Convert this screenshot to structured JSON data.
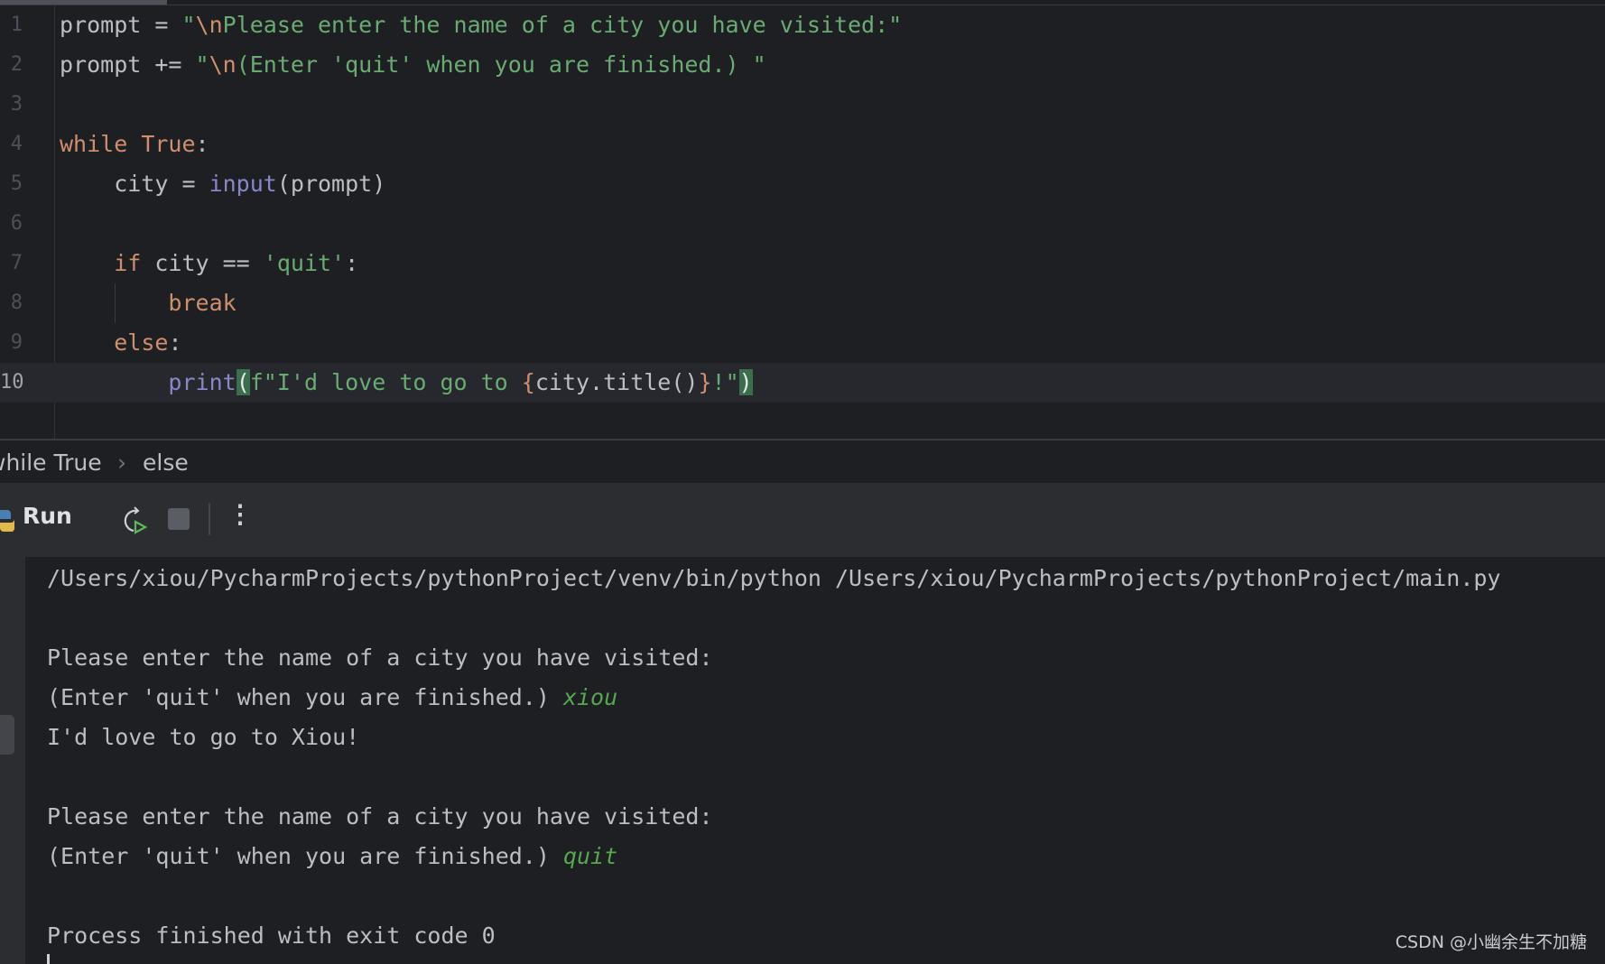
{
  "editor": {
    "lines": [
      {
        "n": "1",
        "tokens": [
          [
            "",
            "prompt = "
          ],
          [
            "str",
            "\""
          ],
          [
            "esc",
            "\\n"
          ],
          [
            "str",
            "Please enter the name of a city you have visited:\""
          ]
        ]
      },
      {
        "n": "2",
        "tokens": [
          [
            "",
            "prompt += "
          ],
          [
            "str",
            "\""
          ],
          [
            "esc",
            "\\n"
          ],
          [
            "str",
            "(Enter 'quit' when you are finished.) \""
          ]
        ]
      },
      {
        "n": "3",
        "tokens": []
      },
      {
        "n": "4",
        "tokens": [
          [
            "kw",
            "while "
          ],
          [
            "kw",
            "True"
          ],
          [
            "",
            ":"
          ]
        ]
      },
      {
        "n": "5",
        "tokens": [
          [
            "",
            "    city = "
          ],
          [
            "bi",
            "input"
          ],
          [
            "",
            "(prompt)"
          ]
        ]
      },
      {
        "n": "6",
        "tokens": []
      },
      {
        "n": "7",
        "tokens": [
          [
            "",
            "    "
          ],
          [
            "kw",
            "if"
          ],
          [
            "",
            " city == "
          ],
          [
            "str",
            "'quit'"
          ],
          [
            "",
            ":"
          ]
        ]
      },
      {
        "n": "8",
        "tokens": [
          [
            "",
            "        "
          ],
          [
            "kw",
            "break"
          ]
        ]
      },
      {
        "n": "9",
        "tokens": [
          [
            "",
            "    "
          ],
          [
            "kw",
            "else"
          ],
          [
            "",
            ":"
          ]
        ]
      },
      {
        "n": "10",
        "tokens": [
          [
            "",
            "        "
          ],
          [
            "bi",
            "print"
          ],
          [
            "hl",
            "("
          ],
          [
            "str",
            "f\"I'd love to go to "
          ],
          [
            "br",
            "{"
          ],
          [
            "",
            "city.title()"
          ],
          [
            "br",
            "}"
          ],
          [
            "str",
            "!\""
          ],
          [
            "hl",
            ")"
          ]
        ]
      }
    ],
    "current_line": "10"
  },
  "breadcrumb": [
    "while True",
    "else"
  ],
  "breadcrumb_sep": "›",
  "run": {
    "label": "Run",
    "more": "⋮"
  },
  "console": {
    "lines": [
      [
        [
          "",
          "/Users/xiou/PycharmProjects/pythonProject/venv/bin/python /Users/xiou/PycharmProjects/pythonProject/main.py"
        ]
      ],
      [],
      [
        [
          "",
          "Please enter the name of a city you have visited:"
        ]
      ],
      [
        [
          "",
          "(Enter 'quit' when you are finished.) "
        ],
        [
          "inp",
          "xiou"
        ]
      ],
      [
        [
          "",
          "I'd love to go to Xiou!"
        ]
      ],
      [],
      [
        [
          "",
          "Please enter the name of a city you have visited:"
        ]
      ],
      [
        [
          "",
          "(Enter 'quit' when you are finished.) "
        ],
        [
          "inp",
          "quit"
        ]
      ],
      [],
      [
        [
          "",
          "Process finished with exit code 0"
        ]
      ]
    ]
  },
  "watermark": "CSDN @小幽余生不加糖"
}
